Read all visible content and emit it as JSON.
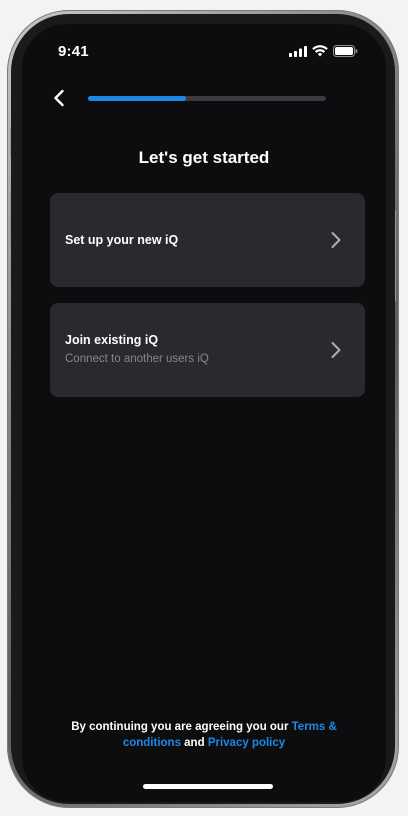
{
  "status_bar": {
    "time": "9:41",
    "icons": [
      "cellular-signal-icon",
      "wifi-icon",
      "battery-icon"
    ]
  },
  "header": {
    "back_icon": "chevron-left-icon",
    "progress": 0.41
  },
  "title": "Let's get started",
  "options": [
    {
      "title": "Set up your new iQ",
      "subtitle": "",
      "icon": "chevron-right-icon"
    },
    {
      "title": "Join existing iQ",
      "subtitle": "Connect to another users iQ",
      "icon": "chevron-right-icon"
    }
  ],
  "legal": {
    "prefix": "By continuing you are agreeing you our ",
    "terms_link": "Terms & conditions",
    "middle": " and ",
    "privacy_link": "Privacy policy"
  },
  "colors": {
    "accent": "#1e88e5",
    "background": "#0d0d0f",
    "card": "#2a2a2e",
    "secondary_text": "#86868c"
  }
}
